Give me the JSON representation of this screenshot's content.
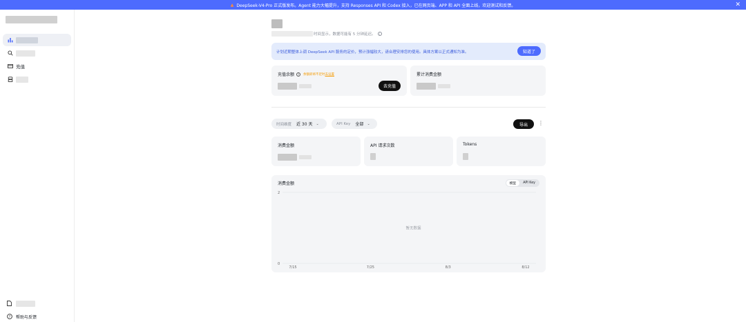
{
  "banner": {
    "text": "DeepSeek-V4-Pro 正式版发布。Agent 能力大幅提升，支持 Responses API 和 Codex 接入，已在网页端、APP 和 API 全面上线，欢迎测试和反馈。",
    "close": "✕"
  },
  "sidebar": {
    "items": [
      {
        "label": ""
      },
      {
        "label": ""
      },
      {
        "label": "充值"
      },
      {
        "label": ""
      }
    ],
    "bottom": [
      {
        "label": ""
      },
      {
        "label": "帮助与反馈"
      }
    ]
  },
  "page": {
    "subtitle": "时间显示，数据可能有 5 分钟延迟。"
  },
  "notice": {
    "text": "计划近期整体上调 DeepSeek API 服务的定价，预计涨幅较大，请合理安排您的使用。具体方案以正式通知为准。",
    "button": "知道了"
  },
  "balance_card": {
    "title": "充值余额",
    "warning": "余额即将不足时",
    "warning_link": "去设置",
    "recharge_button": "去充值"
  },
  "total_card": {
    "title": "累计消费金额"
  },
  "filters": {
    "time_key": "时间维度",
    "time_value": "近 30 天",
    "key_key": "API Key",
    "key_value": "全部",
    "export": "导出"
  },
  "stats": [
    {
      "title": "消费金额"
    },
    {
      "title": "API 请求次数"
    },
    {
      "title": "Tokens"
    }
  ],
  "chart_card": {
    "title": "消费金额",
    "toggle": [
      "模型",
      "API Key"
    ]
  },
  "chart_data": {
    "type": "line",
    "x": [
      "7/15",
      "7/25",
      "8/3",
      "8/12"
    ],
    "series": [],
    "ylim": [
      0,
      2
    ],
    "yticks": [
      "0",
      "2"
    ],
    "empty_text": "暂无数据",
    "grid": true
  }
}
